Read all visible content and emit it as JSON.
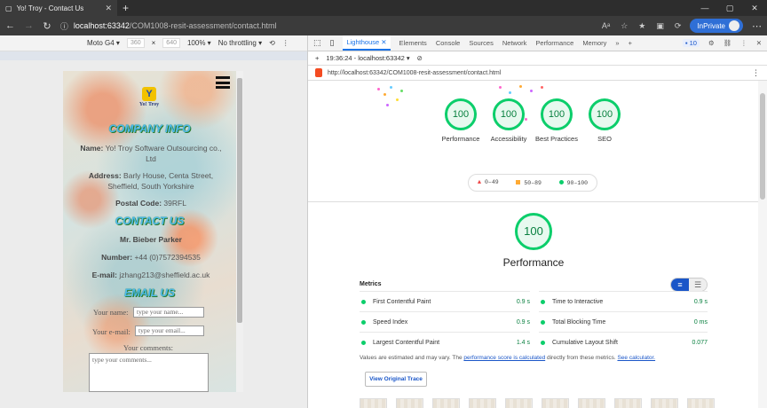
{
  "browser": {
    "tab_title": "Yo! Troy - Contact Us",
    "new_tab": "+",
    "url_host": "localhost:63342",
    "url_path": "/COM1008-resit-assessment/contact.html",
    "inprivate_label": "InPrivate"
  },
  "device_toolbar": {
    "device": "Moto G4",
    "width": "360",
    "height": "640",
    "zoom": "100%",
    "throttle": "No throttling"
  },
  "site": {
    "logo_mark": "Y",
    "logo_text": "Yo! Troy",
    "company_heading": "COMPANY INFO",
    "name_label": "Name:",
    "name_value": "Yo! Troy Software Outsourcing co., Ltd",
    "address_label": "Address:",
    "address_value": "Barly House, Centa Street, Sheffield, South Yorkshire",
    "postal_label": "Postal Code:",
    "postal_value": "39RFL",
    "contact_heading": "CONTACT US",
    "contact_person": "Mr. Bieber Parker",
    "number_label": "Number:",
    "number_value": "+44 (0)7572394535",
    "email_label": "E-mail:",
    "email_value": "jzhang213@sheffield.ac.uk",
    "email_heading": "EMAIL US",
    "form_name_label": "Your name:",
    "form_name_placeholder": "type your name...",
    "form_email_label": "Your e-mail:",
    "form_email_placeholder": "type your email...",
    "form_comments_label": "Your comments:",
    "form_comments_placeholder": "type your comments..."
  },
  "devtools": {
    "tabs": [
      "Lighthouse",
      "Elements",
      "Console",
      "Sources",
      "Network",
      "Performance",
      "Memory"
    ],
    "more_tabs": "»",
    "add_tab": "+",
    "issues_count": "10",
    "report_time": "19:36:24 - localhost:63342",
    "report_url": "http://localhost:63342/COM1008-resit-assessment/contact.html"
  },
  "lighthouse": {
    "scores": [
      {
        "label": "Performance",
        "value": "100"
      },
      {
        "label": "Accessibility",
        "value": "100"
      },
      {
        "label": "Best Practices",
        "value": "100"
      },
      {
        "label": "SEO",
        "value": "100"
      }
    ],
    "legend_fail": "0–49",
    "legend_average": "50–89",
    "legend_pass": "90–100",
    "section_score": "100",
    "section_title": "Performance",
    "metrics_heading": "Metrics",
    "metrics": [
      {
        "name": "First Contentful Paint",
        "value": "0.9 s"
      },
      {
        "name": "Time to Interactive",
        "value": "0.9 s"
      },
      {
        "name": "Speed Index",
        "value": "0.9 s"
      },
      {
        "name": "Total Blocking Time",
        "value": "0 ms"
      },
      {
        "name": "Largest Contentful Paint",
        "value": "1.4 s"
      },
      {
        "name": "Cumulative Layout Shift",
        "value": "0.077"
      }
    ],
    "note_prefix": "Values are estimated and may vary. The ",
    "note_link": "performance score is calculated",
    "note_middle": " directly from these metrics. ",
    "note_link2": "See calculator.",
    "view_trace": "View Original Trace"
  },
  "colors": {
    "pass": "#0cce6b",
    "accent": "#1a56c8",
    "heading": "#4fb8ea"
  }
}
